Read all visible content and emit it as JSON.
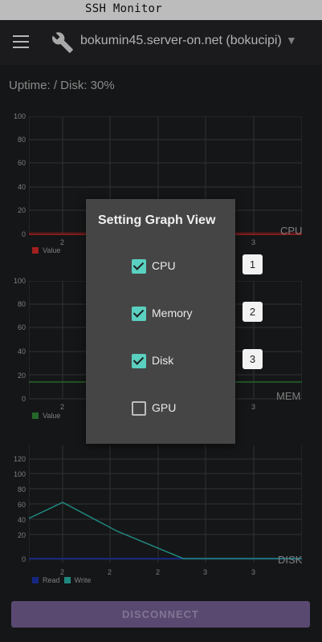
{
  "titlebar": {
    "title": "SSH Monitor"
  },
  "appbar": {
    "server": "bokumin45.server-on.net (bokucipi)",
    "menu_icon": "hamburger-icon",
    "server_icon": "wrench-icon",
    "dropdown_icon": "dropdown-arrow-icon"
  },
  "status": {
    "uptime_text": "Uptime:  / Disk: 30%"
  },
  "charts": {
    "cpu": {
      "title": "CPU",
      "y_ticks": [
        "100",
        "80",
        "60",
        "40",
        "20",
        "0"
      ],
      "x_ticks": [
        "2",
        "2",
        "2",
        "3",
        "3"
      ],
      "legend": "Value",
      "color": "#c62828"
    },
    "mem": {
      "title": "MEM",
      "y_ticks": [
        "100",
        "80",
        "60",
        "40",
        "20",
        "0"
      ],
      "x_ticks": [
        "2",
        "2",
        "2",
        "3",
        "3"
      ],
      "legend": "Value",
      "color": "#2e7d32"
    },
    "disk": {
      "title": "DISK",
      "y_ticks": [
        "120",
        "100",
        "80",
        "60",
        "40",
        "20",
        "0"
      ],
      "x_ticks": [
        "2",
        "2",
        "2",
        "3",
        "3"
      ],
      "legend_read": "Read",
      "legend_write": "Write",
      "read_color": "#1a2f9e",
      "write_color": "#26a69a"
    }
  },
  "chart_data": [
    {
      "type": "line",
      "title": "CPU",
      "ylim": [
        0,
        100
      ],
      "x": [
        1,
        2,
        3,
        4,
        5,
        6
      ],
      "series": [
        {
          "name": "Value",
          "values": [
            1,
            1,
            1,
            1,
            1,
            1
          ]
        }
      ]
    },
    {
      "type": "line",
      "title": "MEM",
      "ylim": [
        0,
        100
      ],
      "x": [
        1,
        2,
        3,
        4,
        5,
        6
      ],
      "series": [
        {
          "name": "Value",
          "values": [
            15,
            15,
            15,
            15,
            15,
            15
          ]
        }
      ]
    },
    {
      "type": "line",
      "title": "DISK",
      "ylim": [
        0,
        130
      ],
      "x": [
        1,
        2,
        3,
        4,
        5,
        6
      ],
      "series": [
        {
          "name": "Read",
          "values": [
            0,
            0,
            0,
            0,
            0,
            0
          ]
        },
        {
          "name": "Write",
          "values": [
            48,
            67,
            32,
            0,
            0,
            0
          ]
        }
      ]
    }
  ],
  "dialog": {
    "title": "Setting Graph View",
    "options": [
      {
        "label": "CPU",
        "checked": true,
        "order": "1"
      },
      {
        "label": "Memory",
        "checked": true,
        "order": "2"
      },
      {
        "label": "Disk",
        "checked": true,
        "order": "3"
      },
      {
        "label": "GPU",
        "checked": false
      }
    ]
  },
  "footer": {
    "disconnect_label": "DISCONNECT"
  }
}
